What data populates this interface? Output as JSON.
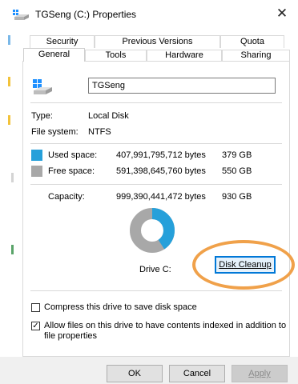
{
  "window": {
    "title": "TGSeng (C:) Properties",
    "close_glyph": "✕"
  },
  "tabs_row1": [
    {
      "label": "Security"
    },
    {
      "label": "Previous Versions"
    },
    {
      "label": "Quota"
    }
  ],
  "tabs_row2": [
    {
      "label": "General",
      "active": true
    },
    {
      "label": "Tools"
    },
    {
      "label": "Hardware"
    },
    {
      "label": "Sharing"
    }
  ],
  "general": {
    "drive_name": "TGSeng",
    "type_label": "Type:",
    "type_value": "Local Disk",
    "fs_label": "File system:",
    "fs_value": "NTFS",
    "used_label": "Used space:",
    "used_bytes": "407,991,795,712 bytes",
    "used_size": "379 GB",
    "free_label": "Free space:",
    "free_bytes": "591,398,645,760 bytes",
    "free_size": "550 GB",
    "capacity_label": "Capacity:",
    "capacity_bytes": "999,390,441,472 bytes",
    "capacity_size": "930 GB",
    "drive_label": "Drive C:",
    "disk_cleanup": "Disk Cleanup",
    "used_fraction": 0.408,
    "colors": {
      "used": "#26a0da",
      "free": "#a8a8a8",
      "highlight": "#f0a14a"
    }
  },
  "options": {
    "compress_label": "Compress this drive to save disk space",
    "compress_checked": false,
    "index_label_line1": "Allow files on this drive to have contents indexed in addition to",
    "index_label_line2": "file properties",
    "index_checked": true
  },
  "buttons": {
    "ok": "OK",
    "cancel": "Cancel",
    "apply": "Apply"
  },
  "icons": {
    "title": "drive-icon",
    "close": "close-icon",
    "drive": "windows-drive-icon"
  }
}
